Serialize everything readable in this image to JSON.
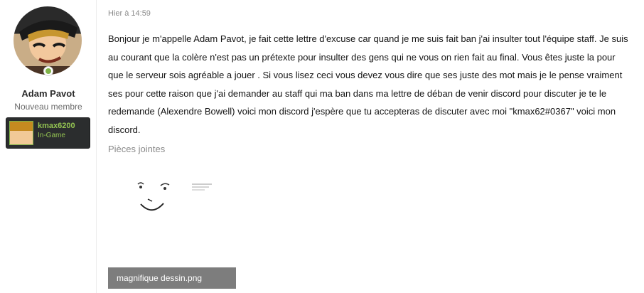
{
  "user": {
    "name": "Adam Pavot",
    "title": "Nouveau membre",
    "online_color": "#7fb347",
    "game_name": "kmax6200",
    "game_status": "In-Game"
  },
  "post": {
    "timestamp": "Hier à 14:59",
    "body": "Bonjour je m'appelle Adam Pavot, je fait cette lettre d'excuse car quand je me suis fait ban j'ai insulter tout l'équipe staff. Je suis au courant que la colère n'est pas un prétexte pour insulter des gens qui ne vous on rien fait au final. Vous êtes juste la pour que le serveur sois agréable a jouer . Si vous lisez ceci vous devez vous dire que ses juste des mot mais je le pense vraiment ses pour cette raison que j'ai demander au staff qui ma ban dans ma lettre de déban de venir discord pour discuter je te le redemande (Alexendre Bowell) voici mon discord j'espère que tu accepteras de discuter avec moi \"kmax62#0367\" voici mon discord."
  },
  "attachments": {
    "label": "Pièces jointes",
    "items": [
      {
        "filename": "magnifique dessin.png"
      }
    ]
  }
}
